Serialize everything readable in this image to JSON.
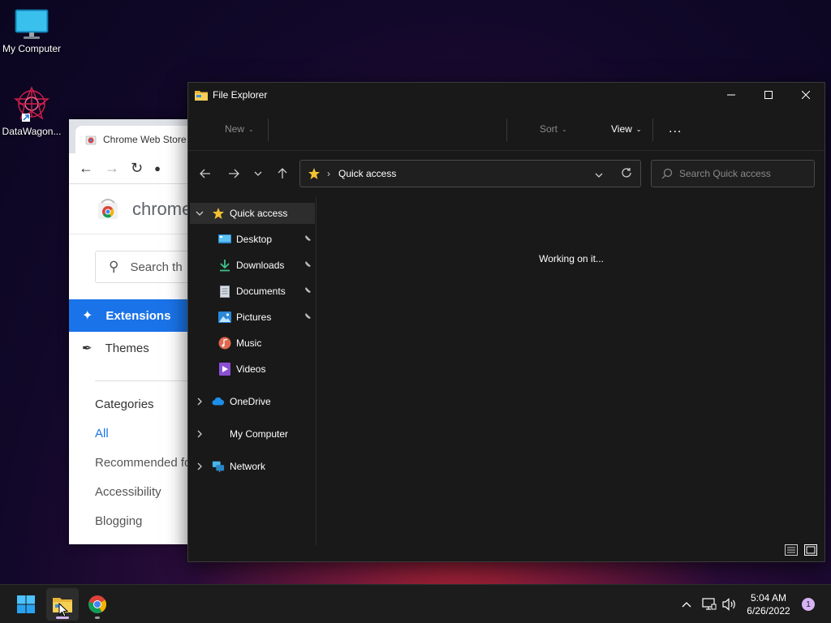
{
  "desktop": {
    "icons": [
      {
        "label": "My Computer",
        "icon": "monitor-icon"
      },
      {
        "label": "DataWagon...",
        "icon": "datawagon-shortcut-icon"
      }
    ]
  },
  "chrome": {
    "tab_title": "Chrome Web Store",
    "store_title": "chrome",
    "search_placeholder": "Search th",
    "nav": [
      {
        "label": "Extensions",
        "active": true,
        "icon": "puzzle-icon"
      },
      {
        "label": "Themes",
        "active": false,
        "icon": "brush-icon"
      }
    ],
    "categories_heading": "Categories",
    "categories": [
      "All",
      "Recommended fo",
      "Accessibility",
      "Blogging"
    ],
    "accent": "#1a73e8"
  },
  "explorer": {
    "window_title": "File Explorer",
    "commands": {
      "new": "New",
      "sort": "Sort",
      "view": "View",
      "more": "..."
    },
    "address": {
      "location": "Quick access"
    },
    "search_placeholder": "Search Quick access",
    "tree": [
      {
        "label": "Quick access",
        "icon": "star-icon",
        "expanded": true,
        "selected": true
      },
      {
        "label": "Desktop",
        "icon": "desktop-folder-icon",
        "pinned": true
      },
      {
        "label": "Downloads",
        "icon": "download-icon",
        "pinned": true
      },
      {
        "label": "Documents",
        "icon": "document-icon",
        "pinned": true
      },
      {
        "label": "Pictures",
        "icon": "picture-icon",
        "pinned": true
      },
      {
        "label": "Music",
        "icon": "music-icon",
        "pinned": false
      },
      {
        "label": "Videos",
        "icon": "video-icon",
        "pinned": false
      },
      {
        "label": "OneDrive",
        "icon": "cloud-icon",
        "expanded": false
      },
      {
        "label": "My Computer",
        "icon": "",
        "expanded": false
      },
      {
        "label": "Network",
        "icon": "network-icon",
        "expanded": false
      }
    ],
    "status": "Working on it..."
  },
  "taskbar": {
    "apps": [
      {
        "name": "Start",
        "icon": "windows-start-icon"
      },
      {
        "name": "File Explorer",
        "icon": "folder-icon",
        "active": true
      },
      {
        "name": "Google Chrome",
        "icon": "chrome-icon",
        "running": true
      }
    ],
    "tray": {
      "time": "5:04 AM",
      "date": "6/26/2022",
      "notifications": "1"
    }
  }
}
